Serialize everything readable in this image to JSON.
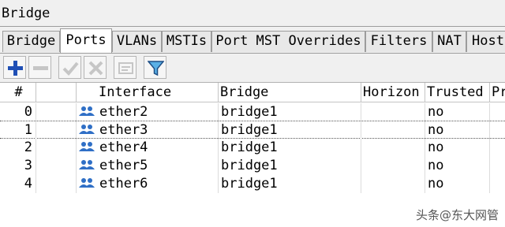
{
  "window": {
    "title": "Bridge"
  },
  "tabs": [
    {
      "label": "Bridge"
    },
    {
      "label": "Ports",
      "active": true
    },
    {
      "label": "VLANs"
    },
    {
      "label": "MSTIs"
    },
    {
      "label": "Port MST Overrides"
    },
    {
      "label": "Filters"
    },
    {
      "label": "NAT"
    },
    {
      "label": "Host"
    }
  ],
  "toolbar": {
    "buttons": [
      "add-icon",
      "remove-icon",
      "enable-icon",
      "disable-icon",
      "comment-icon",
      "filter-icon"
    ]
  },
  "table": {
    "columns": [
      "#",
      "",
      "Interface",
      "Bridge",
      "Horizon",
      "Trusted",
      "Pr"
    ],
    "rows": [
      {
        "index": "0",
        "interface": "ether2",
        "bridge": "bridge1",
        "horizon": "",
        "trusted": "no"
      },
      {
        "index": "1",
        "interface": "ether3",
        "bridge": "bridge1",
        "horizon": "",
        "trusted": "no",
        "selected": true
      },
      {
        "index": "2",
        "interface": "ether4",
        "bridge": "bridge1",
        "horizon": "",
        "trusted": "no"
      },
      {
        "index": "3",
        "interface": "ether5",
        "bridge": "bridge1",
        "horizon": "",
        "trusted": "no"
      },
      {
        "index": "4",
        "interface": "ether6",
        "bridge": "bridge1",
        "horizon": "",
        "trusted": "no"
      }
    ]
  },
  "watermark": "头条@东大网管",
  "colors": {
    "accent_blue": "#1f5fbf",
    "icon_blue": "#2f6fc6"
  }
}
